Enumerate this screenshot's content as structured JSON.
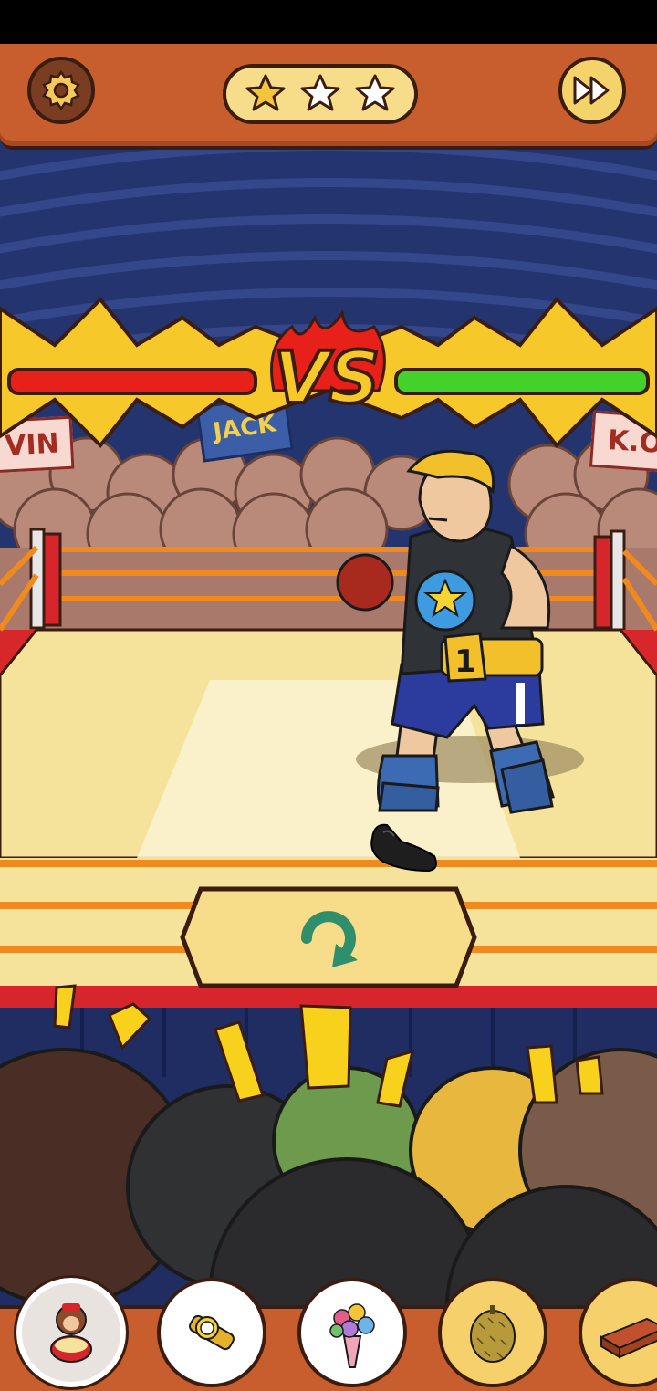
{
  "header": {
    "settings_icon": "gear-icon",
    "skip_icon": "fast-forward-icon",
    "stars": {
      "earned": 1,
      "total": 3
    }
  },
  "battle": {
    "vs_label": "VS",
    "left_health_color": "#e8201a",
    "right_health_color": "#43d12c"
  },
  "crowd_signs": {
    "left": "VIN",
    "center": "JACK",
    "right": "K.O"
  },
  "boxer": {
    "belt_number": "1"
  },
  "controls": {
    "restart_icon": "restart-icon"
  },
  "items": [
    {
      "name": "monkey-toy",
      "icon": "monkey-drum-icon",
      "selected": true
    },
    {
      "name": "wristwatch",
      "icon": "watch-icon",
      "selected": false
    },
    {
      "name": "flower-bouquet",
      "icon": "bouquet-icon",
      "selected": false
    },
    {
      "name": "durian",
      "icon": "durian-icon",
      "selected": false
    },
    {
      "name": "brick",
      "icon": "brick-icon",
      "selected": false
    }
  ],
  "colors": {
    "header": "#c85d2d",
    "star_gold": "#f3c53a",
    "star_empty": "#ffffff",
    "ring_mat": "#f6e39b",
    "ring_post": "#d6262b",
    "rope": "#f08a1e"
  }
}
